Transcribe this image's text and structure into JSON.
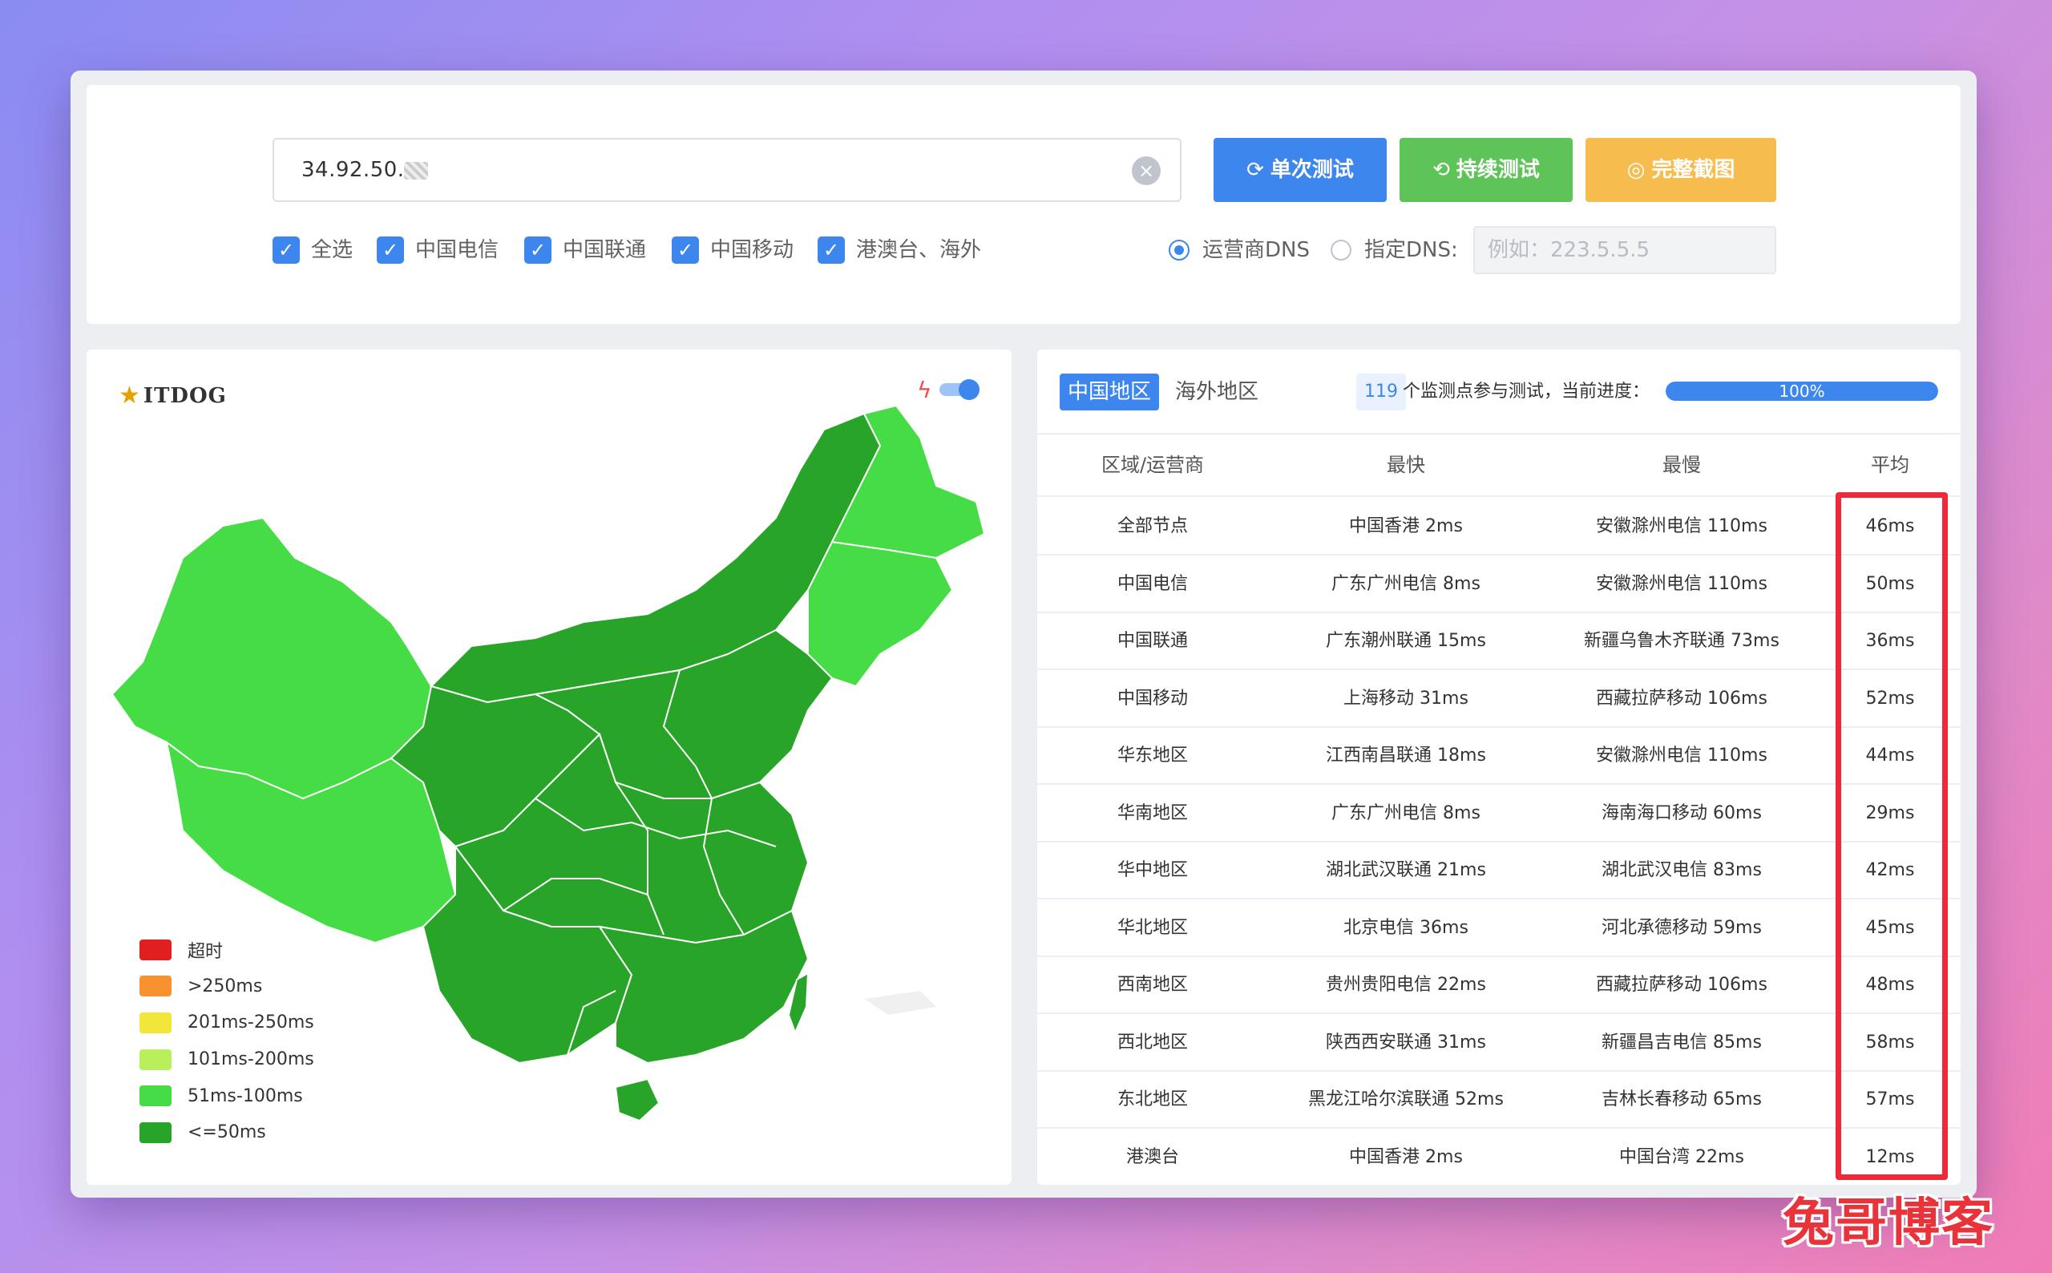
{
  "search": {
    "value": "34.92.50.",
    "clear_icon": "close-circle-icon"
  },
  "buttons": {
    "single_label": "单次测试",
    "continuous_label": "持续测试",
    "screenshot_label": "完整截图",
    "colors": {
      "single": "#3d86ee",
      "continuous": "#5ec45a",
      "screenshot": "#f7bc4e"
    }
  },
  "filters": {
    "all": "全选",
    "telecom": "中国电信",
    "unicom": "中国联通",
    "mobile": "中国移动",
    "overseas": "港澳台、海外"
  },
  "dns": {
    "isp_label": "运营商DNS",
    "custom_label": "指定DNS:",
    "custom_placeholder": "例如：223.5.5.5",
    "selected": "isp"
  },
  "map": {
    "logo_text": "ITDOG",
    "legend": [
      {
        "label": "超时",
        "color": "#e02020"
      },
      {
        "label": ">250ms",
        "color": "#f7922e"
      },
      {
        "label": "201ms-250ms",
        "color": "#f2e63a"
      },
      {
        "label": "101ms-200ms",
        "color": "#b8ef5a"
      },
      {
        "label": "51ms-100ms",
        "color": "#46dc46"
      },
      {
        "label": "<=50ms",
        "color": "#28a428"
      }
    ]
  },
  "results": {
    "tab_china": "中国地区",
    "tab_overseas": "海外地区",
    "node_count": "119",
    "progress_text": "个监测点参与测试，当前进度：",
    "progress_value": "100%",
    "progress_fraction": 1.0,
    "headers": [
      "区域/运营商",
      "最快",
      "最慢",
      "平均"
    ],
    "rows": [
      [
        "全部节点",
        "中国香港 2ms",
        "安徽滁州电信 110ms",
        "46ms"
      ],
      [
        "中国电信",
        "广东广州电信 8ms",
        "安徽滁州电信 110ms",
        "50ms"
      ],
      [
        "中国联通",
        "广东潮州联通 15ms",
        "新疆乌鲁木齐联通 73ms",
        "36ms"
      ],
      [
        "中国移动",
        "上海移动 31ms",
        "西藏拉萨移动 106ms",
        "52ms"
      ],
      [
        "华东地区",
        "江西南昌联通 18ms",
        "安徽滁州电信 110ms",
        "44ms"
      ],
      [
        "华南地区",
        "广东广州电信 8ms",
        "海南海口移动 60ms",
        "29ms"
      ],
      [
        "华中地区",
        "湖北武汉联通 21ms",
        "湖北武汉电信 83ms",
        "42ms"
      ],
      [
        "华北地区",
        "北京电信 36ms",
        "河北承德移动 59ms",
        "45ms"
      ],
      [
        "西南地区",
        "贵州贵阳电信 22ms",
        "西藏拉萨移动 106ms",
        "48ms"
      ],
      [
        "西北地区",
        "陕西西安联通 31ms",
        "新疆昌吉电信 85ms",
        "58ms"
      ],
      [
        "东北地区",
        "黑龙江哈尔滨联通 52ms",
        "吉林长春移动 65ms",
        "57ms"
      ],
      [
        "港澳台",
        "中国香港 2ms",
        "中国台湾 22ms",
        "12ms"
      ]
    ]
  },
  "watermark": "兔哥博客"
}
